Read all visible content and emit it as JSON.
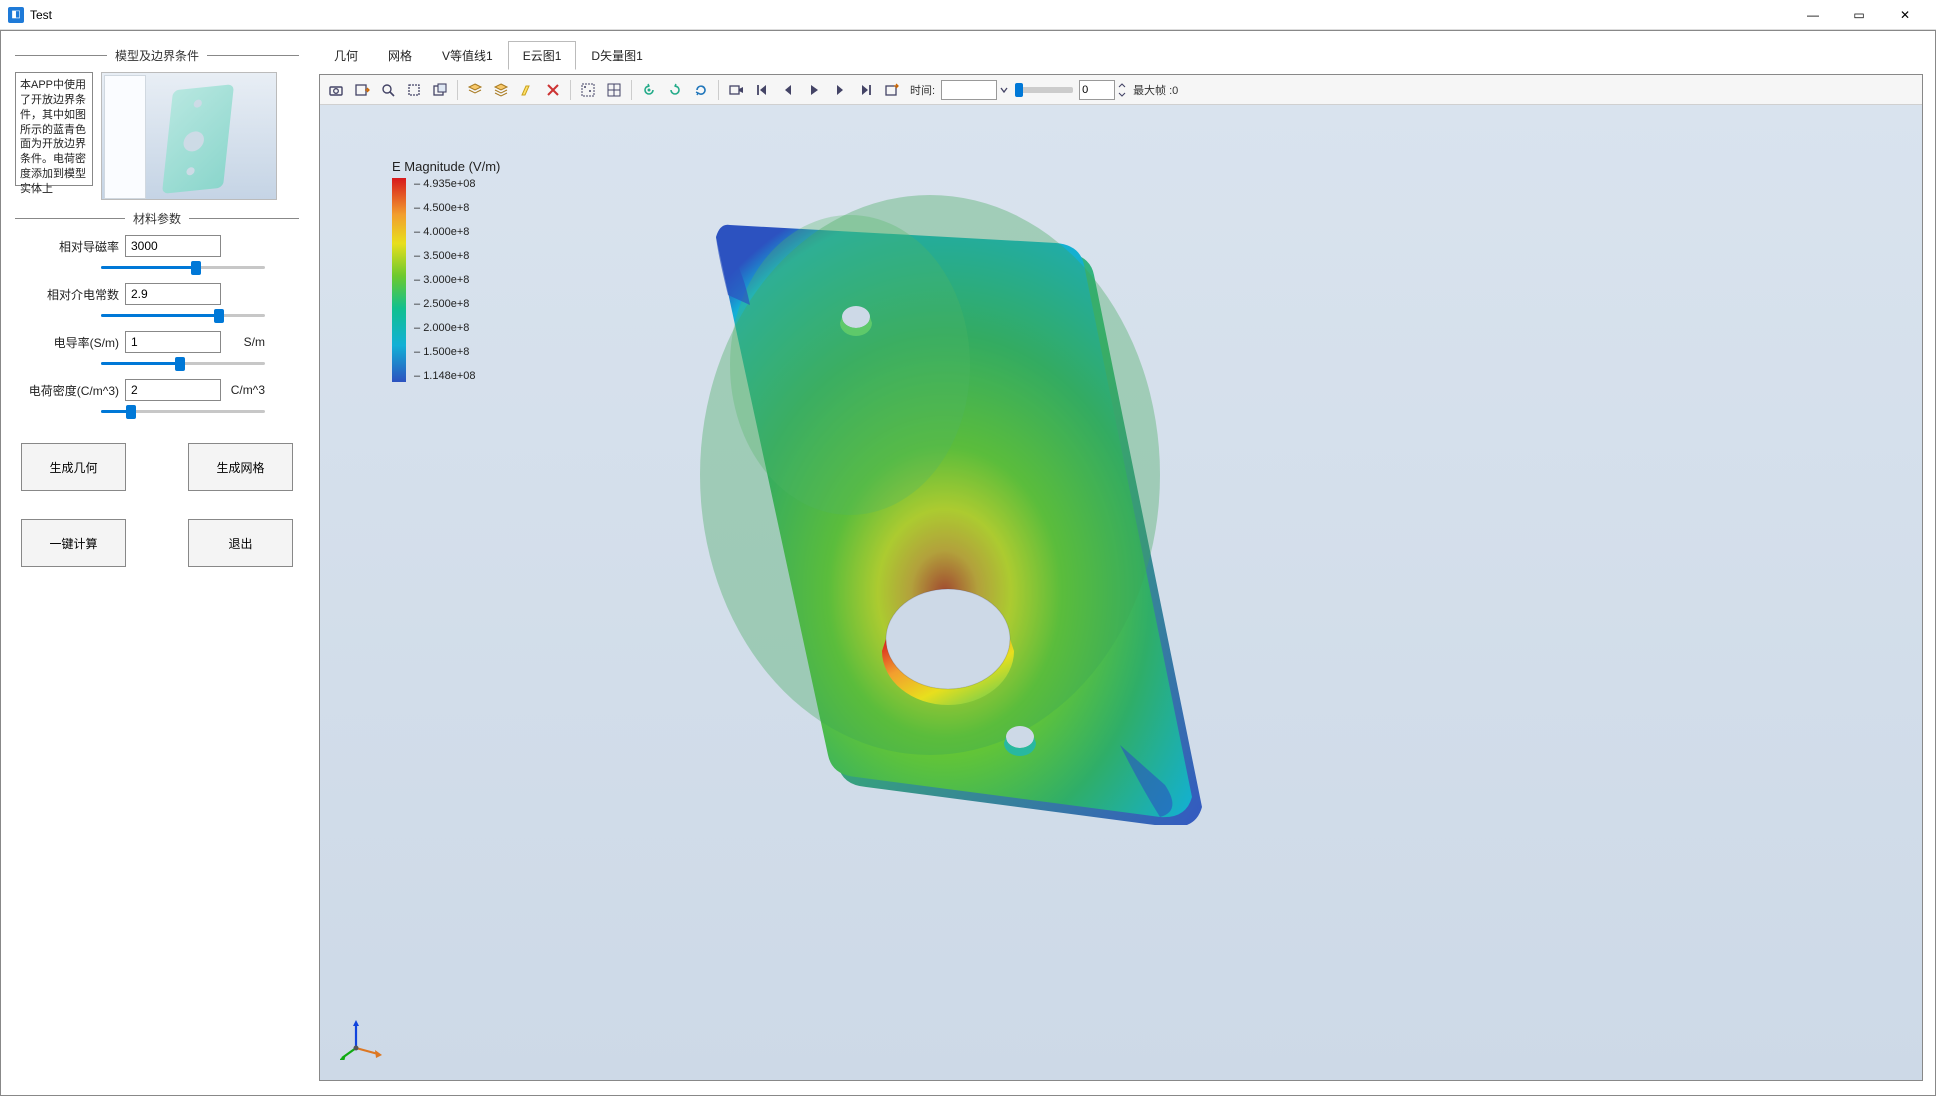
{
  "window": {
    "title": "Test"
  },
  "sidebar": {
    "section_bc_title": "模型及边界条件",
    "desc_text": "本APP中使用了开放边界条件，其中如图所示的蓝青色面为开放边界条件。电荷密度添加到模型实体上",
    "section_mat_title": "材料参数",
    "params": [
      {
        "label": "相对导磁率",
        "value": "3000",
        "unit": "",
        "slider_pct": 58
      },
      {
        "label": "相对介电常数",
        "value": "2.9",
        "unit": "",
        "slider_pct": 72
      },
      {
        "label": "电导率(S/m)",
        "value": "1",
        "unit": "S/m",
        "slider_pct": 48
      },
      {
        "label": "电荷密度(C/m^3)",
        "value": "2",
        "unit": "C/m^3",
        "slider_pct": 18
      }
    ],
    "buttons": {
      "gen_geom": "生成几何",
      "gen_mesh": "生成网格",
      "compute": "一键计算",
      "exit": "退出"
    }
  },
  "tabs": {
    "items": [
      "几何",
      "网格",
      "V等值线1",
      "E云图1",
      "D矢量图1"
    ],
    "active_index": 3
  },
  "toolbar": {
    "time_label": "时间:",
    "time_value": "",
    "frame_value": "0",
    "maxframe_label": "最大帧 :0",
    "icons": [
      "camera-icon",
      "export-image-icon",
      "zoom-icon",
      "select-box-icon",
      "clip-icon",
      "layers-icon",
      "copy-layers-icon",
      "highlight-icon",
      "clear-icon",
      "select-points-icon",
      "grid-icon",
      "rotate-ccw-icon",
      "rotate-cw-icon",
      "refresh-icon",
      "record-icon",
      "first-frame-icon",
      "prev-frame-icon",
      "play-icon",
      "next-frame-icon",
      "last-frame-icon",
      "export-anim-icon"
    ]
  },
  "legend": {
    "title": "E Magnitude (V/m)",
    "ticks": [
      "4.935e+08",
      "4.500e+8",
      "4.000e+8",
      "3.500e+8",
      "3.000e+8",
      "2.500e+8",
      "2.000e+8",
      "1.500e+8",
      "1.148e+08"
    ]
  },
  "chart_data": {
    "type": "heatmap",
    "title": "E Magnitude (V/m)",
    "colorbar_range": [
      114800000.0,
      493500000.0
    ],
    "colorbar_ticks": [
      493500000.0,
      450000000.0,
      400000000.0,
      350000000.0,
      300000000.0,
      250000000.0,
      200000000.0,
      150000000.0,
      114800000.0
    ],
    "note": "3D surface contour of electric field magnitude on a rounded rectangular plate with three circular holes; highest field (red ~4.9e8 V/m) near the large central hole rim, lowest (blue ~1.1e8 V/m) at outer edges/corners."
  }
}
